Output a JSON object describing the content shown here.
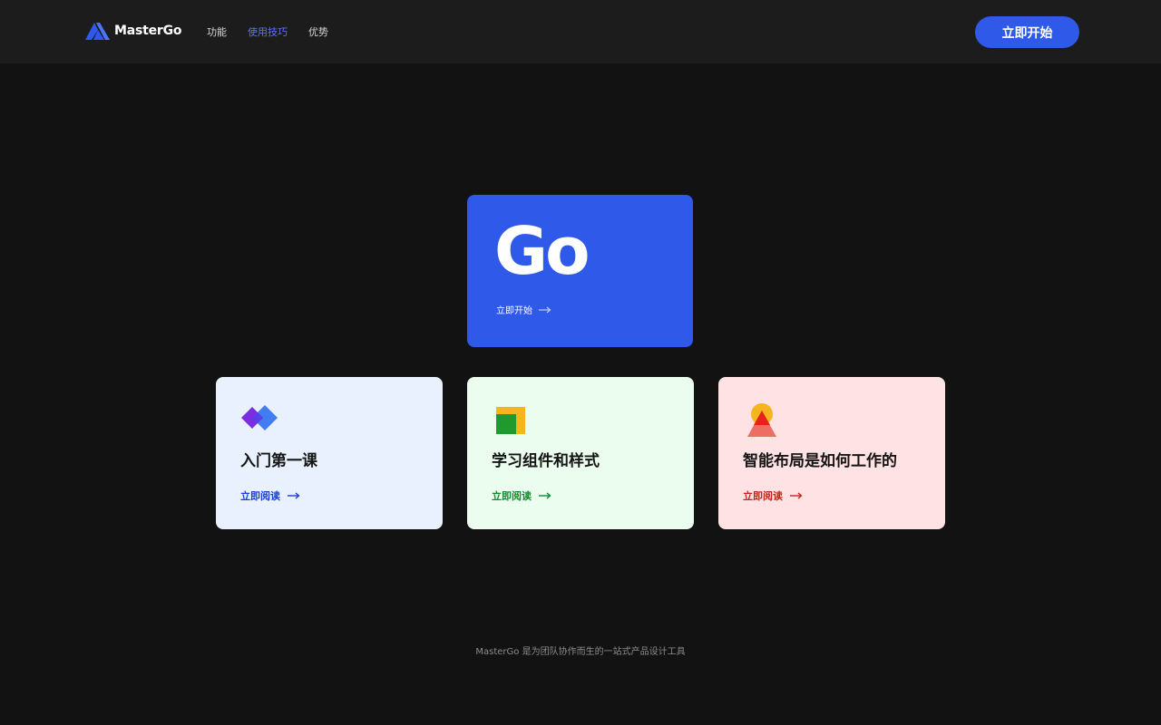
{
  "header": {
    "brand_name": "MasterGo",
    "brand_icon": "mastergo-logo-icon",
    "nav": [
      {
        "label": "功能",
        "active": false
      },
      {
        "label": "使用技巧",
        "active": true
      },
      {
        "label": "优势",
        "active": false
      }
    ],
    "cta_label": "立即开始"
  },
  "hero": {
    "title": "Go",
    "link_label": "立即开始",
    "link_icon": "arrow-right-icon",
    "color": "#2f59e8"
  },
  "cards": [
    {
      "title": "入门第一课",
      "link_label": "立即阅读",
      "icon": "diamond-icon",
      "background": "#e8f1fd",
      "accent": "#1c3fd4"
    },
    {
      "title": "学习组件和样式",
      "link_label": "立即阅读",
      "icon": "square-layers-icon",
      "background": "#eafdef",
      "accent": "#138a2e"
    },
    {
      "title": "智能布局是如何工作的",
      "link_label": "立即阅读",
      "icon": "sun-triangle-icon",
      "background": "#ffe2e3",
      "accent": "#c0271c"
    }
  ],
  "footer": {
    "text": "MasterGo 是为团队协作而生的一站式产品设计工具"
  },
  "colors": {
    "page_background": "#121212",
    "header_background": "#1c1c1c",
    "nav_active": "#5b74ff",
    "primary": "#2f59e8"
  }
}
